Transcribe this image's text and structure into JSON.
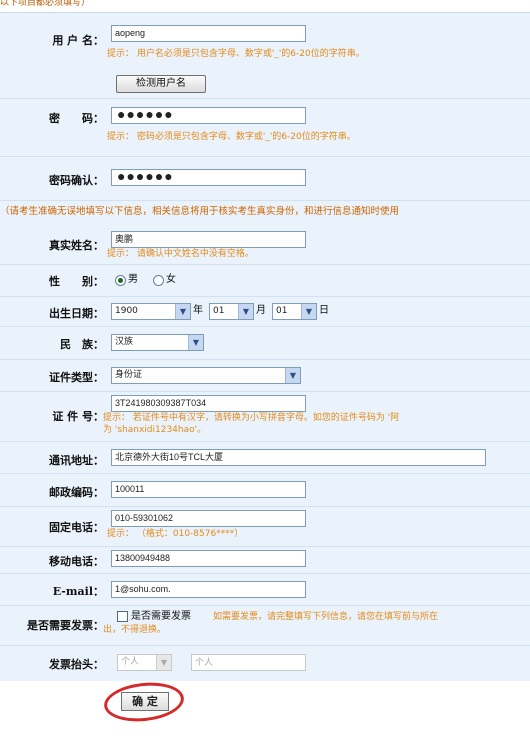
{
  "top_note": "以下项目都必须填写）",
  "notice": "（请考生准确无误地填写以下信息，相关信息将用于核实考生真实身份，和进行信息通知时使用",
  "account": {
    "username": {
      "label": "用 户 名：",
      "value": "aopeng",
      "hint": "提示： 用户名必须是只包含字母、数字或'_'的6-20位的字符串。",
      "check_button": "检测用户名"
    },
    "password": {
      "label": "密　　码：",
      "value": "●●●●●●",
      "hint": "提示： 密码必须是只包含字母、数字或'_'的6-20位的字符串。"
    },
    "password_confirm": {
      "label": "密码确认：",
      "value": "●●●●●●"
    }
  },
  "personal": {
    "real_name": {
      "label": "真实姓名：",
      "value": "奥鹏",
      "hint": "提示： 请确认中文姓名中没有空格。"
    },
    "gender": {
      "label": "性　　别：",
      "options": [
        "男",
        "女"
      ],
      "selected": "男"
    },
    "birth_date": {
      "label": "出生日期：",
      "year": "1900",
      "year_unit": "年",
      "month": "01",
      "month_unit": "月",
      "day": "01",
      "day_unit": "日"
    },
    "ethnicity": {
      "label": "民　族：",
      "value": "汉族"
    },
    "id_type": {
      "label": "证件类型：",
      "value": "身份证"
    },
    "id_number": {
      "label": "证 件 号：",
      "value": "3T241980309387T034",
      "hint_line1": "提示： 若证件号中有汉字，请转换为小写拼音字母。如您的证件号码为 '阿",
      "hint_line2": "为 'shanxidi1234hao'。"
    },
    "address": {
      "label": "通讯地址：",
      "value": "北京德外大街10号TCL大厦"
    },
    "postal_code": {
      "label": "邮政编码：",
      "value": "100011"
    },
    "phone": {
      "label": "固定电话：",
      "value": "010-59301062",
      "hint": "提示： （格式：010-8576****）"
    },
    "mobile": {
      "label": "移动电话：",
      "value": "13800949488"
    },
    "email": {
      "label": "E-mail：",
      "value": "1@sohu.com."
    },
    "invoice_needed": {
      "label": "是否需要发票：",
      "checkbox_label": "是否需要发票",
      "hint_line1": "如需要发票，请完整填写下列信息，请您在填写前与所在",
      "hint_line2": "出，不得退换。",
      "checked": false
    },
    "invoice_title": {
      "label": "发票抬头：",
      "select_value": "个人",
      "input_value": "个人"
    }
  },
  "submit_label": "确 定"
}
